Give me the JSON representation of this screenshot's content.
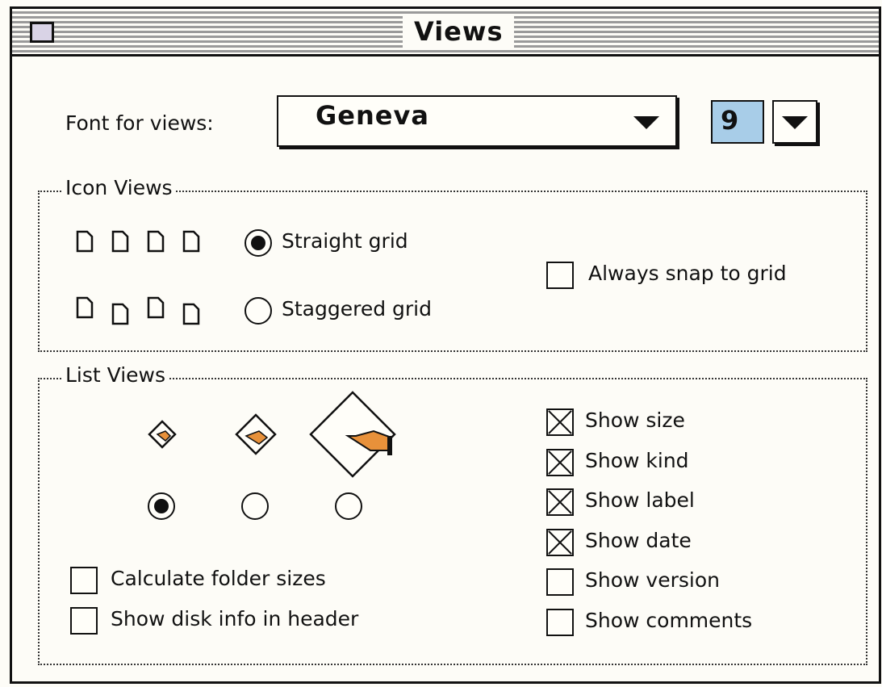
{
  "window": {
    "title": "Views"
  },
  "font": {
    "label": "Font for views:",
    "family": "Geneva",
    "size": "9"
  },
  "icon_views": {
    "label": "Icon Views",
    "straight": "Straight grid",
    "staggered": "Staggered grid",
    "snap": "Always snap to grid",
    "selected": "straight",
    "snap_checked": false
  },
  "list_views": {
    "label": "List Views",
    "icon_size_selected": 0,
    "calc_folder": "Calculate folder sizes",
    "disk_info": "Show disk info in header",
    "options": [
      {
        "label": "Show size",
        "checked": true
      },
      {
        "label": "Show kind",
        "checked": true
      },
      {
        "label": "Show label",
        "checked": true
      },
      {
        "label": "Show date",
        "checked": true
      },
      {
        "label": "Show version",
        "checked": false
      },
      {
        "label": "Show comments",
        "checked": false
      }
    ]
  },
  "colors": {
    "size_highlight": "#a8cde8",
    "hand": "#e8913a"
  }
}
